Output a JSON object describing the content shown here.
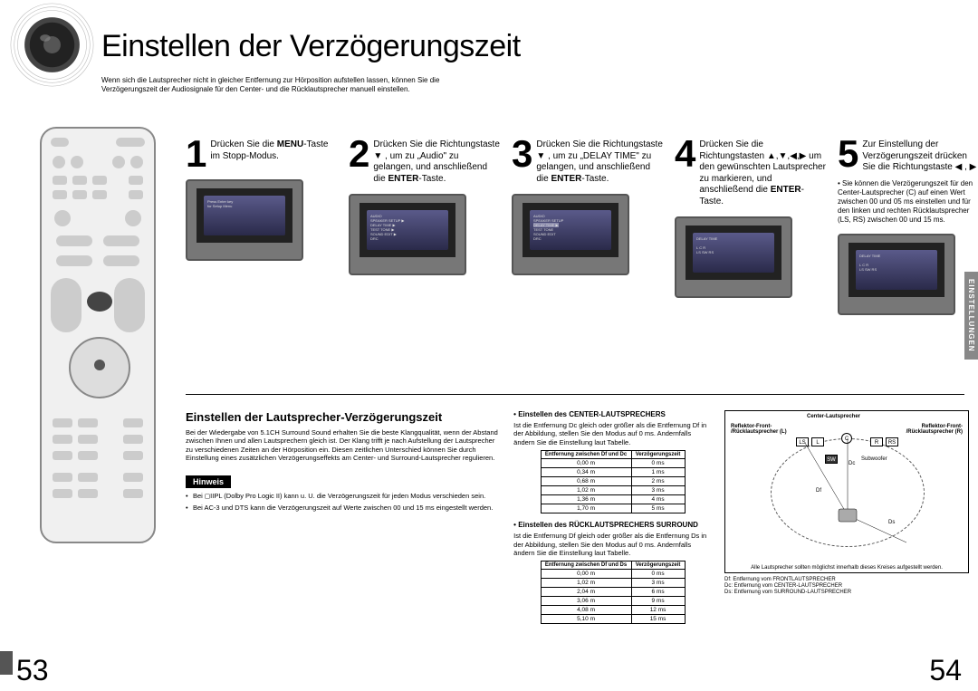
{
  "header": {
    "title": "Einstellen der Verzögerungszeit",
    "subtitle": "Wenn sich die Lautsprecher nicht in gleicher Entfernung zur Hörposition aufstellen lassen, können Sie die Verzögerungszeit der Audiosignale für den Center- und die Rücklautsprecher manuell einstellen."
  },
  "side_tab": "EINSTELLUNGEN",
  "steps": [
    {
      "num": "1",
      "text_html": "Drücken Sie die <b>MENU</b>-Taste im Stopp-Modus."
    },
    {
      "num": "2",
      "text_html": "Drücken Sie die Richtungstaste ▼ , um zu „Audio\" zu gelangen, und anschließend die <b>ENTER</b>-Taste."
    },
    {
      "num": "3",
      "text_html": "Drücken Sie die Richtungstaste ▼ , um zu „DELAY TIME\" zu gelangen, und anschließend die <b>ENTER</b>-Taste."
    },
    {
      "num": "4",
      "text_html": "Drücken Sie die Richtungstasten ▲,▼,◀,▶ um den gewünschten Lautsprecher zu markieren, und anschließend die <b>ENTER</b>-Taste."
    },
    {
      "num": "5",
      "text_html": "Zur Einstellung der Verzögerungszeit drücken Sie die Richtungstaste ◀ , ▶ .",
      "note": "• Sie können die Verzögerungszeit für den Center-Lautsprecher (C) auf einen Wert zwischen 00 und 05 ms einstellen und für den linken und rechten Rücklautsprecher (LS, RS) zwischen 00 und 15 ms."
    }
  ],
  "lower": {
    "col1": {
      "title": "Einstellen der Lautsprecher-Verzögerungszeit",
      "body": "Bei der Wiedergabe von 5.1CH Surround Sound erhalten Sie die beste Klangqualität, wenn der Abstand zwischen Ihnen und allen Lautsprechern gleich ist. Der Klang trifft je nach Aufstellung der Lautsprecher zu verschiedenen Zeiten an der Hörposition ein. Diesen zeitlichen Unterschied können Sie durch Einstellung eines zusätzlichen Verzögerungseffekts am Center- und Surround-Lautsprecher regulieren.",
      "hinweis_label": "Hinweis",
      "hinweis_items": [
        "Bei ◻IIPL (Dolby Pro Logic II) kann u. U. die Verzögerungszeit für jeden Modus verschieden sein.",
        "Bei AC-3 und DTS kann die Verzögerungszeit auf Werte zwischen 00 und 15 ms eingestellt werden."
      ]
    },
    "col2": {
      "center_title": "Einstellen des CENTER-LAUTSPRECHERS",
      "center_body": "Ist die Entfernung Dc gleich oder größer als die Entfernung Df in der Abbildung, stellen Sie den Modus auf 0 ms. Andernfalls ändern Sie die Einstellung laut Tabelle.",
      "table1_h1": "Entfernung zwischen Df und Dc",
      "table1_h2": "Verzögerungszeit",
      "table1_rows": [
        [
          "0,00 m",
          "0 ms"
        ],
        [
          "0,34 m",
          "1 ms"
        ],
        [
          "0,68 m",
          "2 ms"
        ],
        [
          "1,02 m",
          "3 ms"
        ],
        [
          "1,36 m",
          "4 ms"
        ],
        [
          "1,70 m",
          "5 ms"
        ]
      ],
      "rear_title": "Einstellen des RÜCKLAUTSPRECHERS SURROUND",
      "rear_body": "Ist die Entfernung Df gleich oder größer als die Entfernung Ds in der Abbildung, stellen Sie den Modus auf 0 ms. Andernfalls ändern Sie die Einstellung laut Tabelle.",
      "table2_h1": "Entfernung zwischen Df und Ds",
      "table2_h2": "Verzögerungszeit",
      "table2_rows": [
        [
          "0,00 m",
          "0 ms"
        ],
        [
          "1,02 m",
          "3 ms"
        ],
        [
          "2,04 m",
          "6 ms"
        ],
        [
          "3,06 m",
          "9 ms"
        ],
        [
          "4,08 m",
          "12 ms"
        ],
        [
          "5,10 m",
          "15 ms"
        ]
      ]
    },
    "col3": {
      "labels": {
        "center": "Center-Lautsprecher",
        "left_front": "Reflektor-Front-\n/Rücklautsprecher (L)",
        "right_front": "Reflektor-Front-\n/Rücklautsprecher (R)",
        "subwoofer": "Subwoofer",
        "ls": "LS",
        "l": "L",
        "c": "C",
        "r": "R",
        "rs": "RS",
        "sw": "SW",
        "dc": "Dc",
        "df": "Df",
        "ds": "Ds"
      },
      "caption": "Alle Lautsprecher sollten möglichst innerhalb dieses Kreises aufgestellt werden.",
      "legend": [
        "Df: Entfernung vom FRONTLAUTSPRECHER",
        "Dc: Entfernung vom CENTER-LAUTSPRECHER",
        "Ds: Entfernung vom SURROUND-LAUTSPRECHER"
      ]
    }
  },
  "page_left": "53",
  "page_right": "54"
}
